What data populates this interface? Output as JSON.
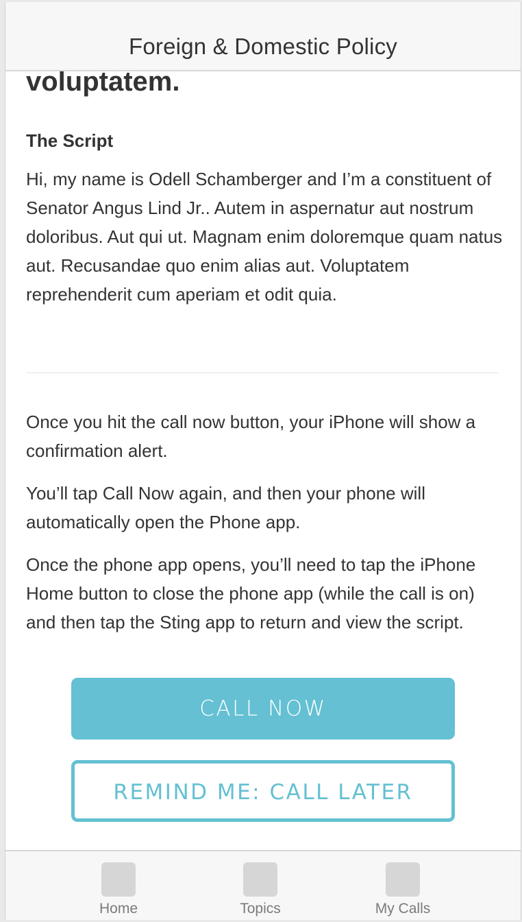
{
  "navbar": {
    "title": "Foreign & Domestic Policy"
  },
  "issue": {
    "title_fragment": "voluptatem."
  },
  "script": {
    "heading": "The Script",
    "body": "Hi, my name is Odell Schamberger and I’m a constituent of Senator Angus Lind Jr.. Autem in aspernatur aut nostrum doloribus. Aut qui ut. Magnam enim doloremque quam natus aut. Recusandae quo enim alias aut. Voluptatem reprehenderit cum aperiam et odit quia."
  },
  "instructions": [
    "Once you hit the call now button, your iPhone will show a confirmation alert.",
    "You’ll tap Call Now again, and then your phone will automatically open the Phone app.",
    "Once the phone app opens, you’ll need to tap the iPhone Home button to close the phone app (while the call is on) and then tap the Sting app to return and view the script."
  ],
  "buttons": {
    "call_now": "CALL NOW",
    "remind_me": "REMIND ME: CALL LATER"
  },
  "tabbar": {
    "items": [
      {
        "label": "Home",
        "icon": "home-icon"
      },
      {
        "label": "Topics",
        "icon": "topics-icon"
      },
      {
        "label": "My Calls",
        "icon": "my-calls-icon"
      }
    ]
  },
  "colors": {
    "accent": "#64c0d2",
    "text": "#333333",
    "tab_label": "#7a7a7a",
    "bar_background": "#f7f7f7"
  }
}
